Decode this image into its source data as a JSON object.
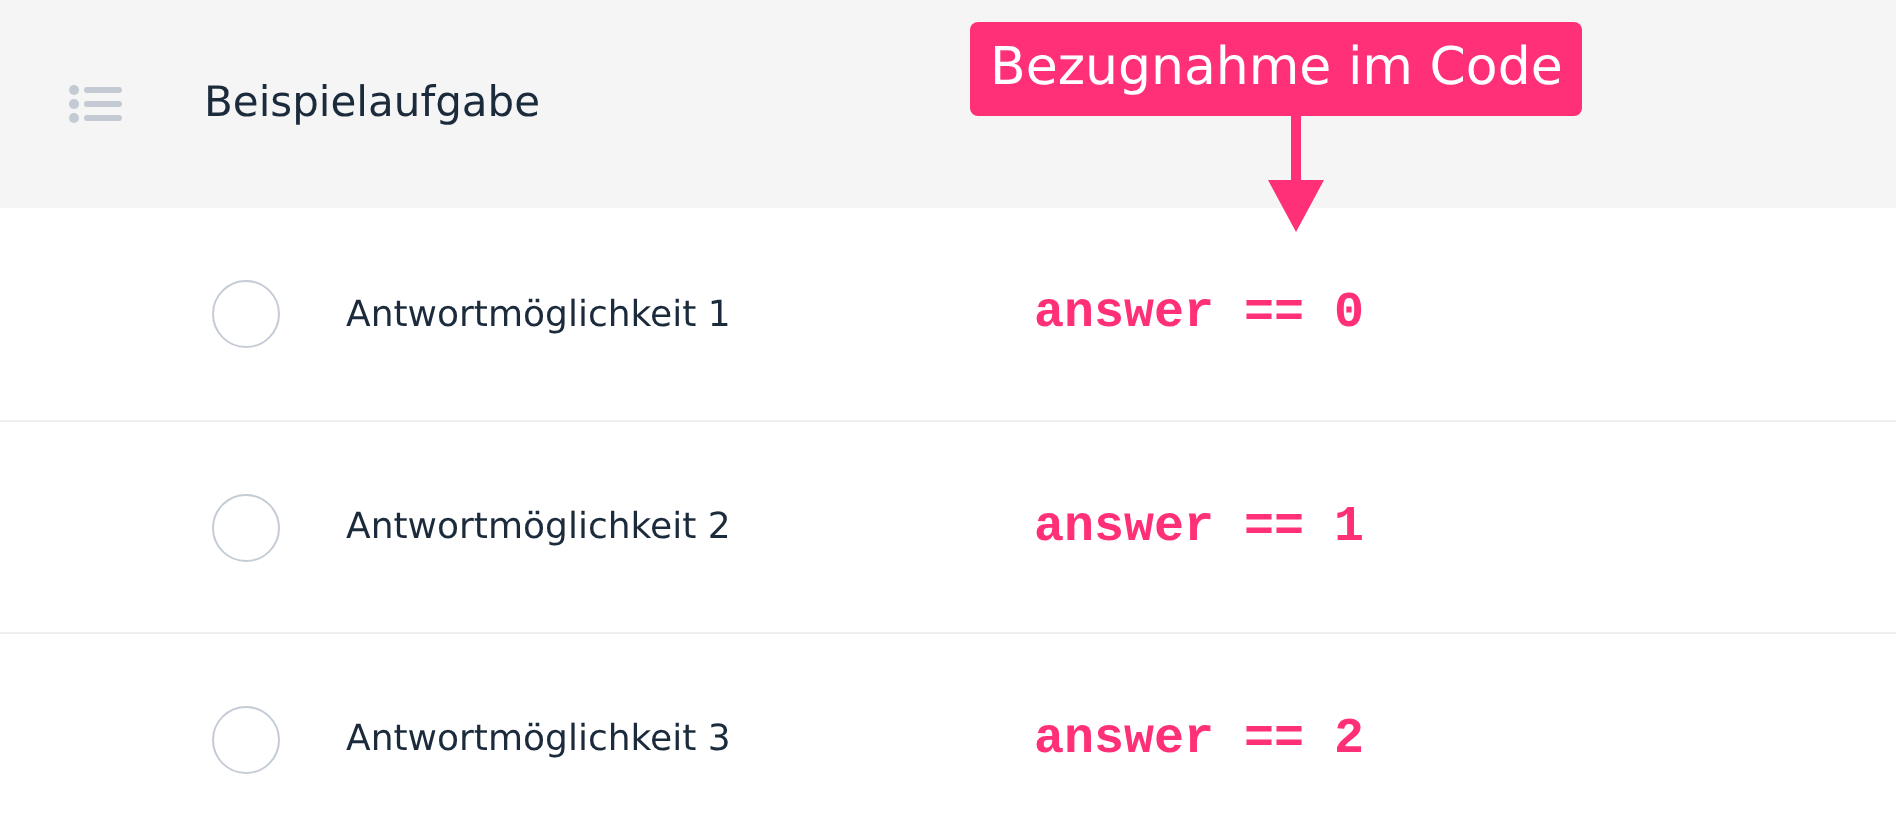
{
  "header": {
    "title": "Beispielaufgabe"
  },
  "options": [
    {
      "label": "Antwortmöglichkeit 1",
      "selected": false,
      "code": "answer == 0"
    },
    {
      "label": "Antwortmöglichkeit 2",
      "selected": false,
      "code": "answer == 1"
    },
    {
      "label": "Antwortmöglichkeit 3",
      "selected": false,
      "code": "answer == 2"
    }
  ],
  "callout": {
    "text": "Bezugnahme im Code"
  }
}
